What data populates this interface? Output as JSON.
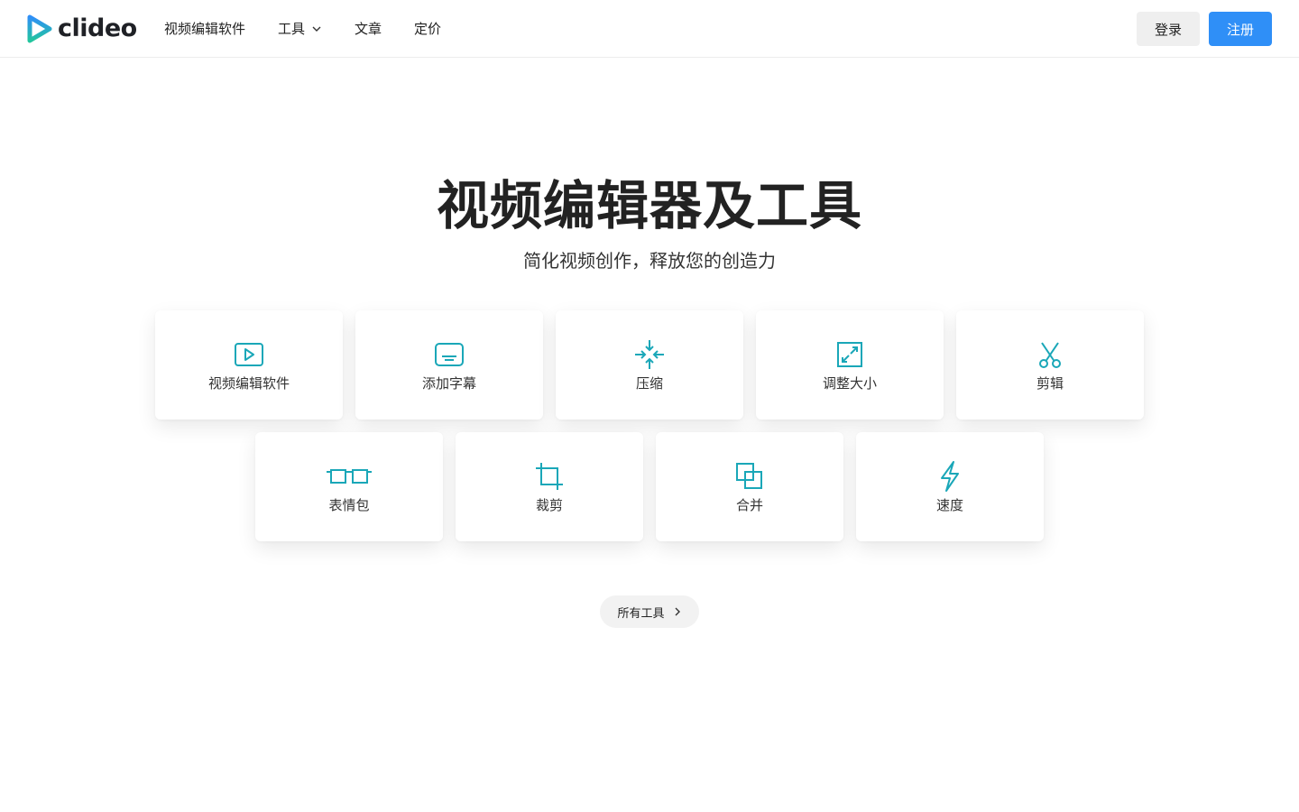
{
  "brand": {
    "name": "clideo",
    "colors": {
      "accent": "#2f8ff7",
      "icon": "#1aa7b8",
      "logo_gradient_top": "#2f8ff7",
      "logo_gradient_bottom": "#22c59e"
    }
  },
  "header": {
    "nav": [
      {
        "label": "视频编辑软件"
      },
      {
        "label": "工具",
        "has_dropdown": true,
        "icon": "chevron-down-icon"
      },
      {
        "label": "文章"
      },
      {
        "label": "定价"
      }
    ],
    "login_label": "登录",
    "signup_label": "注册"
  },
  "hero": {
    "title": "视频编辑器及工具",
    "subtitle": "简化视频创作，释放您的创造力"
  },
  "tools": [
    {
      "label": "视频编辑软件",
      "icon": "video-editor-icon"
    },
    {
      "label": "添加字幕",
      "icon": "subtitles-icon"
    },
    {
      "label": "压缩",
      "icon": "compress-icon"
    },
    {
      "label": "调整大小",
      "icon": "resize-icon"
    },
    {
      "label": "剪辑",
      "icon": "scissors-icon"
    },
    {
      "label": "表情包",
      "icon": "meme-icon"
    },
    {
      "label": "裁剪",
      "icon": "crop-icon"
    },
    {
      "label": "合并",
      "icon": "merge-icon"
    },
    {
      "label": "速度",
      "icon": "speed-icon"
    }
  ],
  "all_tools": {
    "label": "所有工具",
    "icon": "chevron-right-icon"
  }
}
